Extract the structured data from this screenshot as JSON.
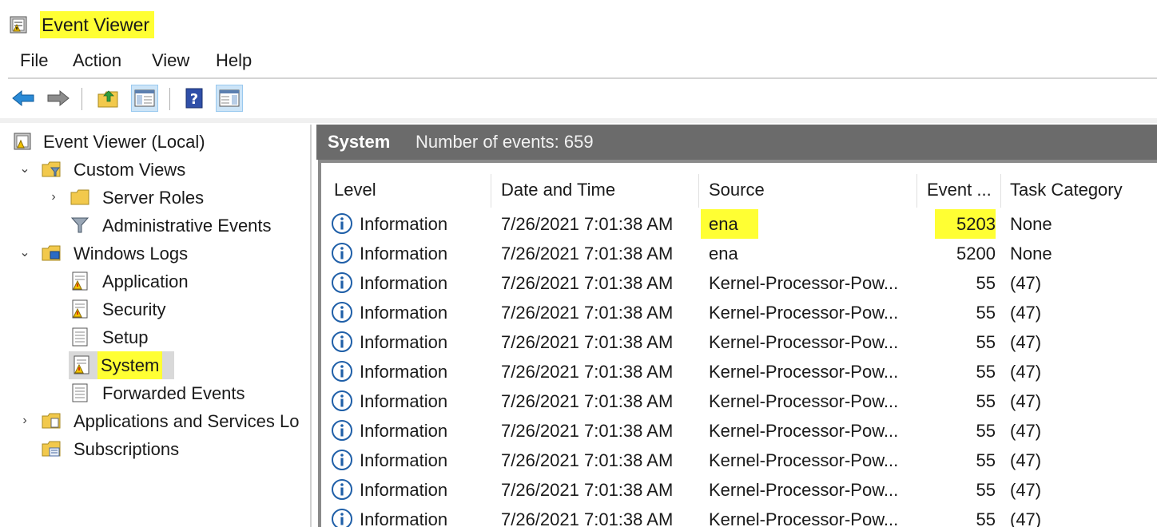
{
  "window": {
    "title": "Event Viewer"
  },
  "menu": [
    "File",
    "Action",
    "View",
    "Help"
  ],
  "toolbar": [
    "back-icon",
    "forward-icon",
    "up-folder-icon",
    "show-hide-console-tree-icon",
    "help-icon",
    "show-hide-action-pane-icon"
  ],
  "tree": {
    "root": "Event Viewer (Local)",
    "custom_views": "Custom Views",
    "server_roles": "Server Roles",
    "administrative_events": "Administrative Events",
    "windows_logs": "Windows Logs",
    "application": "Application",
    "security": "Security",
    "setup": "Setup",
    "system": "System",
    "forwarded_events": "Forwarded Events",
    "apps_services": "Applications and Services Lo",
    "subscriptions": "Subscriptions"
  },
  "pane": {
    "title": "System",
    "count_label": "Number of events: 659"
  },
  "columns": {
    "level": "Level",
    "datetime": "Date and Time",
    "source": "Source",
    "event": "Event ...",
    "task": "Task Category"
  },
  "rows": [
    {
      "level": "Information",
      "datetime": "7/26/2021 7:01:38 AM",
      "source": "ena",
      "event": "5203",
      "task": "None"
    },
    {
      "level": "Information",
      "datetime": "7/26/2021 7:01:38 AM",
      "source": "ena",
      "event": "5200",
      "task": "None"
    },
    {
      "level": "Information",
      "datetime": "7/26/2021 7:01:38 AM",
      "source": "Kernel-Processor-Pow...",
      "event": "55",
      "task": "(47)"
    },
    {
      "level": "Information",
      "datetime": "7/26/2021 7:01:38 AM",
      "source": "Kernel-Processor-Pow...",
      "event": "55",
      "task": "(47)"
    },
    {
      "level": "Information",
      "datetime": "7/26/2021 7:01:38 AM",
      "source": "Kernel-Processor-Pow...",
      "event": "55",
      "task": "(47)"
    },
    {
      "level": "Information",
      "datetime": "7/26/2021 7:01:38 AM",
      "source": "Kernel-Processor-Pow...",
      "event": "55",
      "task": "(47)"
    },
    {
      "level": "Information",
      "datetime": "7/26/2021 7:01:38 AM",
      "source": "Kernel-Processor-Pow...",
      "event": "55",
      "task": "(47)"
    },
    {
      "level": "Information",
      "datetime": "7/26/2021 7:01:38 AM",
      "source": "Kernel-Processor-Pow...",
      "event": "55",
      "task": "(47)"
    },
    {
      "level": "Information",
      "datetime": "7/26/2021 7:01:38 AM",
      "source": "Kernel-Processor-Pow...",
      "event": "55",
      "task": "(47)"
    },
    {
      "level": "Information",
      "datetime": "7/26/2021 7:01:38 AM",
      "source": "Kernel-Processor-Pow...",
      "event": "55",
      "task": "(47)"
    },
    {
      "level": "Information",
      "datetime": "7/26/2021 7:01:38 AM",
      "source": "Kernel-Processor-Pow...",
      "event": "55",
      "task": "(47)"
    }
  ],
  "colors": {
    "highlight": "#ffff33",
    "header_bg": "#6b6b6b",
    "info_blue": "#1f5fa8",
    "folder_yellow": "#f2c94c"
  }
}
